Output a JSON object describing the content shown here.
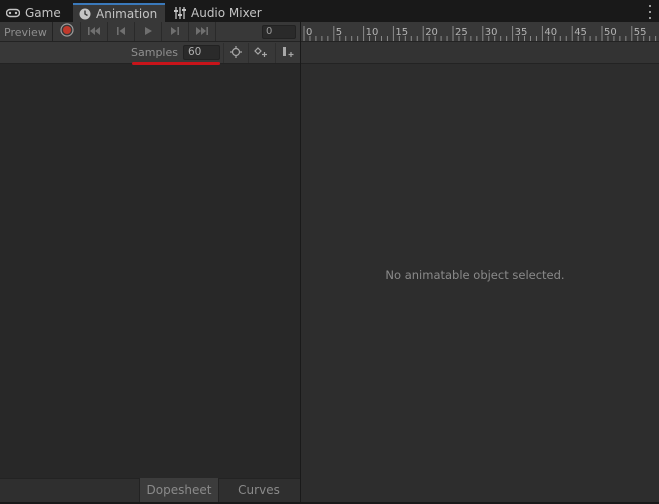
{
  "tabs": [
    {
      "label": "Game",
      "icon": "gamepad-icon"
    },
    {
      "label": "Animation",
      "icon": "animation-clock-icon",
      "active": true
    },
    {
      "label": "Audio Mixer",
      "icon": "mixer-sliders-icon"
    }
  ],
  "toolbar": {
    "preview_label": "Preview",
    "current_frame": "0",
    "samples_label": "Samples",
    "samples_value": "60"
  },
  "timeline": {
    "ticks": [
      "0",
      "5",
      "10",
      "15",
      "20",
      "25",
      "30",
      "35",
      "40",
      "45",
      "50",
      "55"
    ]
  },
  "empty_message": "No animatable object selected.",
  "bottom": {
    "dopesheet_label": "Dopesheet",
    "curves_label": "Curves"
  },
  "colors": {
    "accent_tab": "#3a79bb",
    "record": "#c0392b",
    "annotation_underline": "#c8141a"
  }
}
